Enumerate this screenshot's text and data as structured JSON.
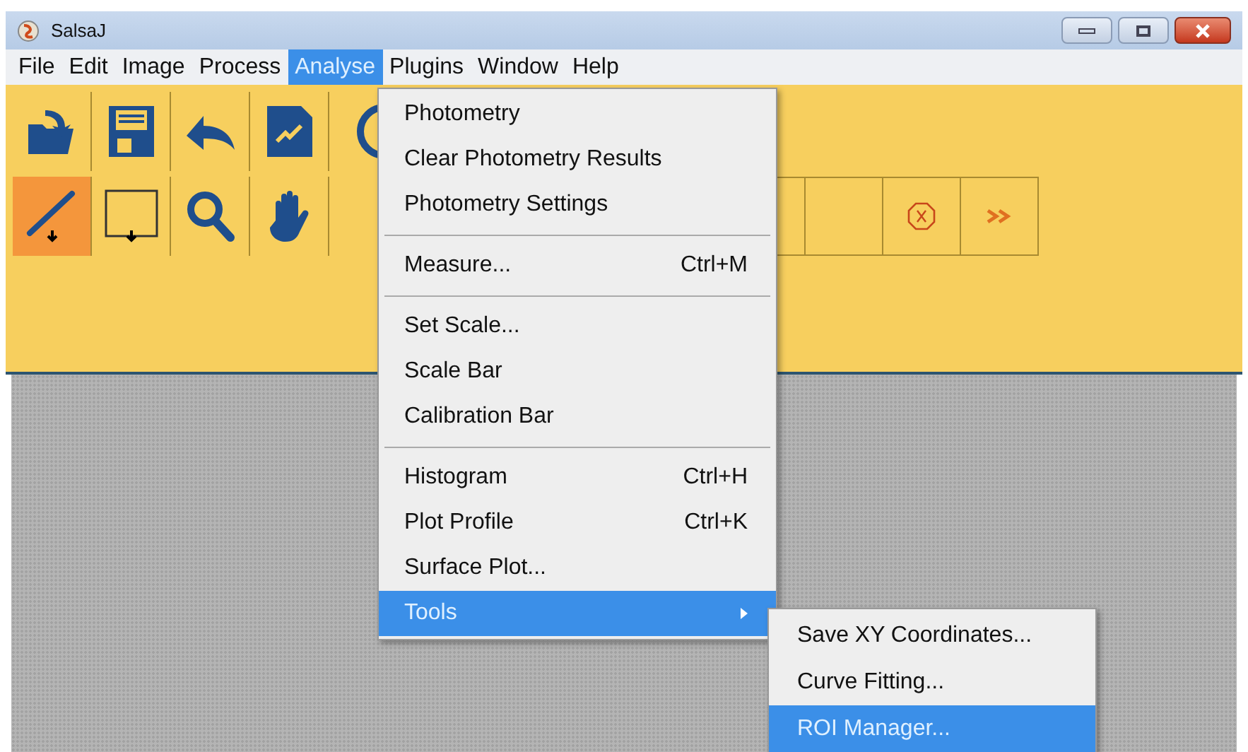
{
  "window": {
    "title": "SalsaJ"
  },
  "menubar": [
    {
      "label": "File",
      "selected": false
    },
    {
      "label": "Edit",
      "selected": false
    },
    {
      "label": "Image",
      "selected": false
    },
    {
      "label": "Process",
      "selected": false
    },
    {
      "label": "Analyse",
      "selected": true
    },
    {
      "label": "Plugins",
      "selected": false
    },
    {
      "label": "Window",
      "selected": false
    },
    {
      "label": "Help",
      "selected": false
    }
  ],
  "toolbar_row1": [
    {
      "kind": "open"
    },
    {
      "kind": "save"
    },
    {
      "kind": "undo"
    },
    {
      "kind": "plot"
    },
    {
      "kind": "half"
    }
  ],
  "toolbar_row2": [
    {
      "kind": "line",
      "selected": true
    },
    {
      "kind": "rect",
      "selected": false
    },
    {
      "kind": "zoom",
      "selected": false
    },
    {
      "kind": "hand",
      "selected": false
    }
  ],
  "toolbar_row2_right": [
    {
      "kind": "empty"
    },
    {
      "kind": "empty"
    },
    {
      "kind": "stop"
    },
    {
      "kind": "more"
    }
  ],
  "menu": [
    {
      "kind": "item",
      "label": "Photometry",
      "selected": false
    },
    {
      "kind": "item",
      "label": "Clear Photometry Results",
      "selected": false
    },
    {
      "kind": "item",
      "label": "Photometry Settings",
      "selected": false
    },
    {
      "kind": "separator"
    },
    {
      "kind": "item",
      "label": "Measure...",
      "shortcut": "Ctrl+M",
      "selected": false
    },
    {
      "kind": "separator"
    },
    {
      "kind": "item",
      "label": "Set Scale...",
      "selected": false
    },
    {
      "kind": "item",
      "label": "Scale Bar",
      "selected": false
    },
    {
      "kind": "item",
      "label": "Calibration Bar",
      "selected": false
    },
    {
      "kind": "separator"
    },
    {
      "kind": "item",
      "label": "Histogram",
      "shortcut": "Ctrl+H",
      "selected": false
    },
    {
      "kind": "item",
      "label": "Plot Profile",
      "shortcut": "Ctrl+K",
      "selected": false
    },
    {
      "kind": "item",
      "label": "Surface Plot...",
      "selected": false
    },
    {
      "kind": "submenu",
      "label": "Tools",
      "selected": true
    }
  ],
  "submenu": [
    {
      "label": "Save XY Coordinates...",
      "selected": false
    },
    {
      "label": "Curve Fitting...",
      "selected": false
    },
    {
      "label": "ROI Manager...",
      "selected": true
    }
  ]
}
